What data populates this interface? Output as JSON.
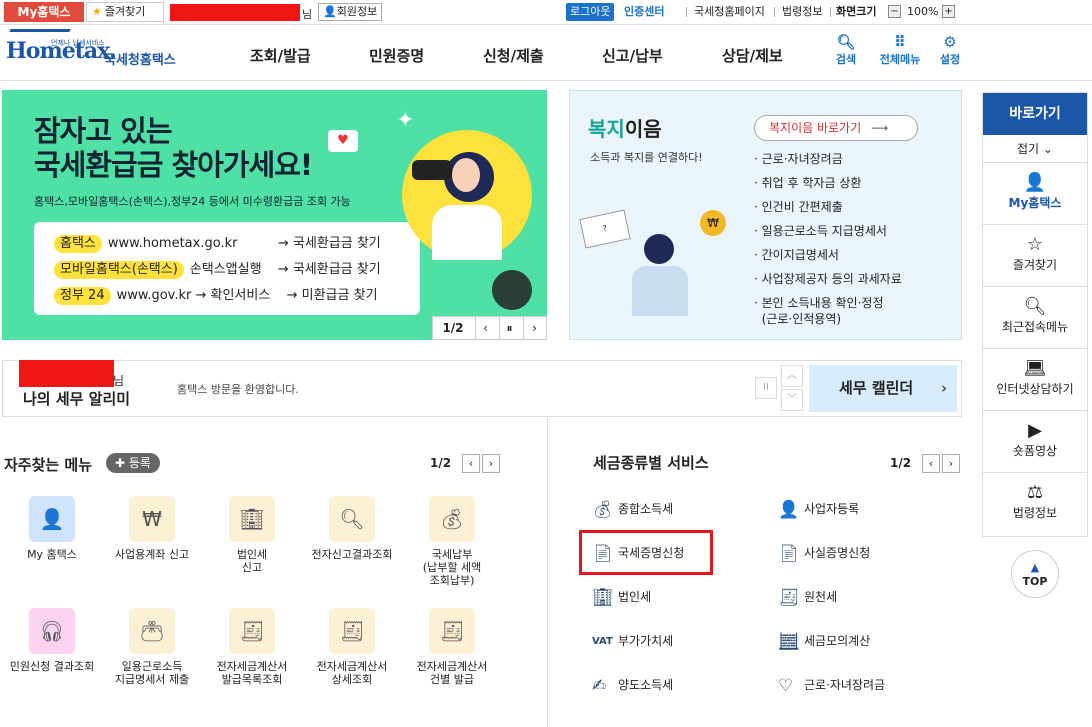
{
  "topbar": {
    "my_tab": "My홈택스",
    "fav_tab": "즐겨찾기",
    "nim": "님",
    "member_info": "회원정보",
    "logout": "로그아웃",
    "cert": "인증센터",
    "links": [
      "국세청홈페이지",
      "법령정보",
      "화면크기"
    ],
    "zoom": "100%"
  },
  "header": {
    "logo_small": "언제나 납세서비스",
    "logo_text": "Hometax.",
    "logo_kr": "국세청홈택스",
    "gnb": [
      "조회/발급",
      "민원증명",
      "신청/제출",
      "신고/납부",
      "상담/제보"
    ],
    "icons": [
      "검색",
      "전체메뉴",
      "설정"
    ]
  },
  "banner": {
    "title_line1": "잠자고 있는",
    "title_line2": "국세환급금 찾아가세요!",
    "subtitle": "홈택스,모바일홈택스(손택스),정부24 등에서 미수령환급금 조회 가능",
    "rows": [
      {
        "tag": "홈택스",
        "site": "www.hometax.go.kr",
        "action": "→ 국세환급금 찾기"
      },
      {
        "tag": "모바일홈택스(손택스)",
        "site": "손택스앱실행",
        "action": "→ 국세환급금 찾기"
      },
      {
        "tag": "정부 24",
        "site": "www.gov.kr → 확인서비스",
        "action": "→ 미환급금 찾기"
      }
    ],
    "pager": "1/2"
  },
  "welfare": {
    "title_a": "복지",
    "title_b": "이음",
    "subtitle": "소득과 복지를 연결하다!",
    "button": "복지이음 바로가기",
    "items": [
      "근로·자녀장려금",
      "취업 후 학자금 상환",
      "인건비 간편제출",
      "일용근로소득 지급명세서",
      "간이지급명세서",
      "사업장제공자 등의 과세자료",
      "본인 소득내용 확인·정정",
      "(근로·인적용역)"
    ]
  },
  "alarm": {
    "nim": "님",
    "title": "나의 세무 알리미",
    "message": "홈택스 방문을 환영합니다.",
    "calendar": "세무 캘린더"
  },
  "favorites": {
    "title": "자주찾는 메뉴",
    "register": "등록",
    "pager": "1/2",
    "items": [
      {
        "label": "My 홈택스",
        "icon": "person-icon"
      },
      {
        "label": "사업용계좌 신고",
        "icon": "bankbook-icon"
      },
      {
        "label": "법인세\n신고",
        "icon": "building-icon"
      },
      {
        "label": "전자신고결과조회",
        "icon": "search-doc-icon"
      },
      {
        "label": "국세납부\n(납부할 세액\n조회납부)",
        "icon": "moneybag-icon"
      },
      {
        "label": "민원신청 결과조회",
        "icon": "headset-icon"
      },
      {
        "label": "일용근로소득\n지급명세서 제출",
        "icon": "wallet-icon"
      },
      {
        "label": "전자세금계산서\n발급목록조회",
        "icon": "invoice-search-icon"
      },
      {
        "label": "전자세금계산서\n상세조회",
        "icon": "invoice-detail-icon"
      },
      {
        "label": "전자세금계산서\n건별 발급",
        "icon": "invoice-add-icon"
      }
    ]
  },
  "taxservice": {
    "title": "세금종류별 서비스",
    "pager": "1/2",
    "items": [
      "종합소득세",
      "사업자등록",
      "국세증명신청",
      "사실증명신청",
      "법인세",
      "원천세",
      "부가가치세",
      "세금모의계산",
      "양도소득세",
      "근로·자녀장려금"
    ]
  },
  "quick": {
    "title": "바로가기",
    "fold": "접기",
    "items": [
      "My홈택스",
      "즐겨찾기",
      "최근접속메뉴",
      "인터넷상담하기",
      "숏폼영상",
      "법령정보"
    ],
    "top": "TOP"
  }
}
